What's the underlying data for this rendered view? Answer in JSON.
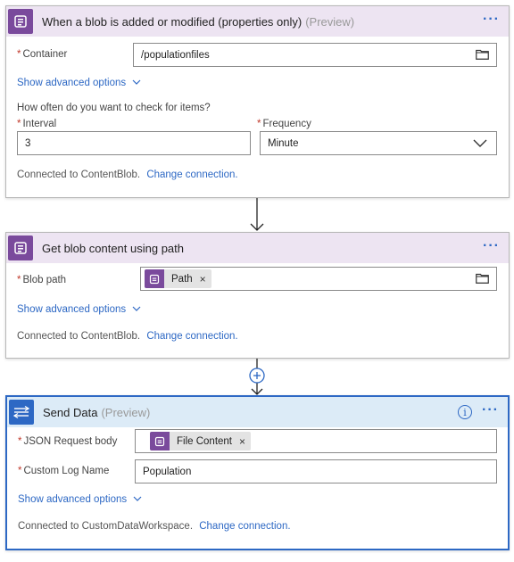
{
  "card1": {
    "title": "When a blob is added or modified (properties only)",
    "preview": "(Preview)",
    "container_label": "Container",
    "container_value": "/populationfiles",
    "advanced_label": "Show advanced options",
    "question": "How often do you want to check for items?",
    "interval_label": "Interval",
    "interval_value": "3",
    "frequency_label": "Frequency",
    "frequency_value": "Minute",
    "connected_text": "Connected to ContentBlob.",
    "change_label": "Change connection."
  },
  "card2": {
    "title": "Get blob content using path",
    "blobpath_label": "Blob path",
    "token_label": "Path",
    "advanced_label": "Show advanced options",
    "connected_text": "Connected to ContentBlob.",
    "change_label": "Change connection."
  },
  "card3": {
    "title": "Send Data",
    "preview": "(Preview)",
    "json_label": "JSON Request body",
    "token_label": "File Content",
    "logname_label": "Custom Log Name",
    "logname_value": "Population",
    "advanced_label": "Show advanced options",
    "connected_text": "Connected to CustomDataWorkspace.",
    "change_label": "Change connection."
  },
  "icons": {
    "card_menu": "ellipsis-icon",
    "info": "info-icon",
    "folder": "folder-icon",
    "chevron": "chevron-down-icon",
    "remove": "close-icon",
    "add_step": "plus-icon"
  },
  "colors": {
    "logic_purple": "#7a4a9c",
    "action_blue": "#2d68c4",
    "header_purple_bg": "#ede4f2",
    "header_blue_bg": "#dcebf7",
    "required": "#c0392b"
  }
}
